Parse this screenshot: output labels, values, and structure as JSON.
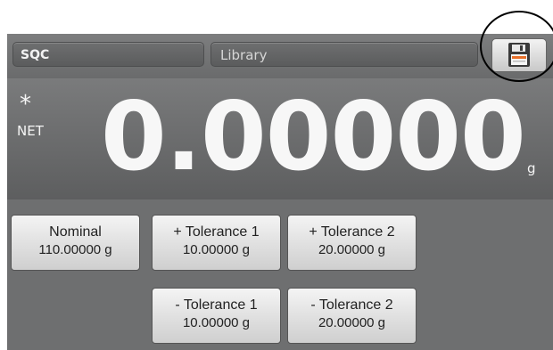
{
  "header": {
    "app_tab": "SQC",
    "library_tab": "Library"
  },
  "icons": {
    "save": "floppy-disk-icon"
  },
  "colors": {
    "screen_bg": "#6f7071",
    "save_icon_accent": "#e8702a"
  },
  "display": {
    "stable_indicator": "*",
    "mode": "NET",
    "reading": "0.00000",
    "unit": "g"
  },
  "params": {
    "nominal": {
      "label": "Nominal",
      "value": "110.00000 g"
    },
    "plus_tol_1": {
      "label": "+ Tolerance 1",
      "value": "10.00000 g"
    },
    "plus_tol_2": {
      "label": "+ Tolerance 2",
      "value": "20.00000 g"
    },
    "minus_tol_1": {
      "label": "- Tolerance 1",
      "value": "10.00000 g"
    },
    "minus_tol_2": {
      "label": "- Tolerance 2",
      "value": "20.00000 g"
    }
  }
}
